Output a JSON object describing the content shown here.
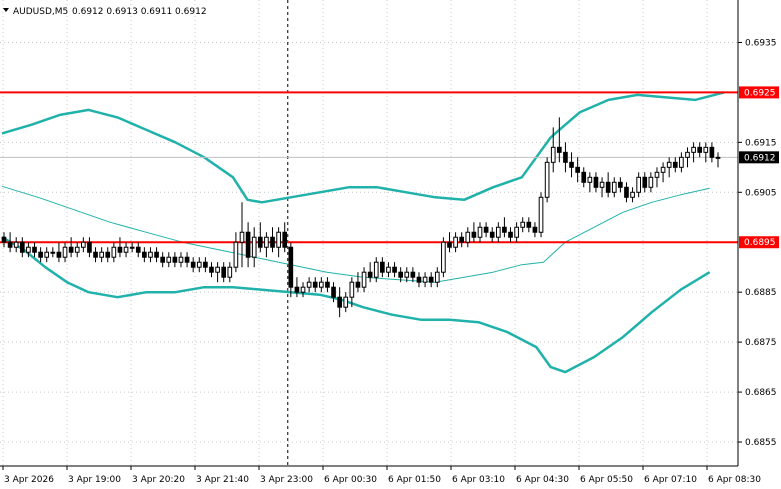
{
  "chart_data": {
    "type": "candlestick",
    "symbol_label": "AUDUSD,M5",
    "ohlc_label": "0.6912 0.6913 0.6911 0.6912",
    "x_ticks": [
      "3 Apr 2026",
      "3 Apr 19:00",
      "3 Apr 20:20",
      "3 Apr 21:40",
      "3 Apr 23:00",
      "6 Apr 00:30",
      "6 Apr 01:50",
      "6 Apr 03:10",
      "6 Apr 04:30",
      "6 Apr 05:50",
      "6 Apr 07:10",
      "6 Apr 08:30"
    ],
    "y_ticks": [
      0.6935,
      0.6915,
      0.6905,
      0.6885,
      0.6875,
      0.6865,
      0.6855
    ],
    "ylim": [
      0.68502,
      0.69435
    ],
    "grid": true,
    "current_price": "0.6912",
    "current_price_value": 0.6912,
    "levels": [
      {
        "label": "0.6925",
        "value": 0.6925
      },
      {
        "label": "0.6895",
        "value": 0.6895
      }
    ],
    "session_break_index": 47,
    "candles": [
      [
        0.6896,
        0.6897,
        0.6894,
        0.6895
      ],
      [
        0.6895,
        0.6897,
        0.6893,
        0.6894
      ],
      [
        0.6894,
        0.6896,
        0.6893,
        0.6895
      ],
      [
        0.6895,
        0.6896,
        0.6892,
        0.6893
      ],
      [
        0.6893,
        0.6895,
        0.6892,
        0.6894
      ],
      [
        0.6894,
        0.6895,
        0.6892,
        0.6893
      ],
      [
        0.6893,
        0.6894,
        0.6891,
        0.6892
      ],
      [
        0.6892,
        0.6894,
        0.6891,
        0.6893
      ],
      [
        0.6893,
        0.6894,
        0.6892,
        0.6893
      ],
      [
        0.6893,
        0.6895,
        0.6891,
        0.6892
      ],
      [
        0.6892,
        0.6895,
        0.6891,
        0.6894
      ],
      [
        0.6894,
        0.6896,
        0.6892,
        0.6893
      ],
      [
        0.6893,
        0.6895,
        0.6892,
        0.6894
      ],
      [
        0.6894,
        0.6896,
        0.6893,
        0.6895
      ],
      [
        0.6895,
        0.6896,
        0.6892,
        0.6893
      ],
      [
        0.6893,
        0.6894,
        0.6891,
        0.6892
      ],
      [
        0.6892,
        0.6894,
        0.6891,
        0.6893
      ],
      [
        0.6893,
        0.6894,
        0.6891,
        0.6892
      ],
      [
        0.6892,
        0.6895,
        0.6891,
        0.6894
      ],
      [
        0.6894,
        0.6896,
        0.6892,
        0.6893
      ],
      [
        0.6893,
        0.6895,
        0.6892,
        0.6894
      ],
      [
        0.6894,
        0.6895,
        0.6893,
        0.6894
      ],
      [
        0.6894,
        0.6895,
        0.6892,
        0.6893
      ],
      [
        0.6893,
        0.6894,
        0.6891,
        0.6892
      ],
      [
        0.6892,
        0.6894,
        0.6891,
        0.6893
      ],
      [
        0.6893,
        0.6894,
        0.6891,
        0.6892
      ],
      [
        0.6892,
        0.6893,
        0.689,
        0.6891
      ],
      [
        0.6891,
        0.6893,
        0.689,
        0.6892
      ],
      [
        0.6892,
        0.6893,
        0.689,
        0.6891
      ],
      [
        0.6891,
        0.6893,
        0.689,
        0.6892
      ],
      [
        0.6892,
        0.6893,
        0.689,
        0.6891
      ],
      [
        0.6891,
        0.6892,
        0.6889,
        0.689
      ],
      [
        0.689,
        0.6892,
        0.6889,
        0.6891
      ],
      [
        0.6891,
        0.6892,
        0.6889,
        0.689
      ],
      [
        0.689,
        0.6891,
        0.6888,
        0.6889
      ],
      [
        0.6889,
        0.6891,
        0.6887,
        0.689
      ],
      [
        0.689,
        0.6891,
        0.6887,
        0.6888
      ],
      [
        0.6888,
        0.6891,
        0.6887,
        0.689
      ],
      [
        0.689,
        0.6897,
        0.6889,
        0.6895
      ],
      [
        0.6895,
        0.6903,
        0.689,
        0.6897
      ],
      [
        0.6897,
        0.6899,
        0.689,
        0.6892
      ],
      [
        0.6892,
        0.6898,
        0.689,
        0.6896
      ],
      [
        0.6896,
        0.6899,
        0.6893,
        0.6894
      ],
      [
        0.6894,
        0.6897,
        0.6892,
        0.6896
      ],
      [
        0.6896,
        0.6898,
        0.6893,
        0.6894
      ],
      [
        0.6894,
        0.6898,
        0.6892,
        0.6897
      ],
      [
        0.6897,
        0.6899,
        0.6893,
        0.6894
      ],
      [
        0.6894,
        0.6895,
        0.6884,
        0.6886
      ],
      [
        0.6886,
        0.6888,
        0.6884,
        0.6885
      ],
      [
        0.6885,
        0.6887,
        0.6884,
        0.6886
      ],
      [
        0.6886,
        0.6888,
        0.6885,
        0.6887
      ],
      [
        0.6887,
        0.6888,
        0.6885,
        0.6886
      ],
      [
        0.6886,
        0.6888,
        0.6885,
        0.6887
      ],
      [
        0.6887,
        0.6888,
        0.6885,
        0.6886
      ],
      [
        0.6886,
        0.6887,
        0.6883,
        0.6884
      ],
      [
        0.6884,
        0.6886,
        0.688,
        0.6882
      ],
      [
        0.6882,
        0.6885,
        0.6881,
        0.6884
      ],
      [
        0.6884,
        0.6888,
        0.6882,
        0.6887
      ],
      [
        0.6887,
        0.6889,
        0.6885,
        0.6886
      ],
      [
        0.6886,
        0.689,
        0.6885,
        0.6889
      ],
      [
        0.6889,
        0.6891,
        0.6887,
        0.6888
      ],
      [
        0.6888,
        0.6892,
        0.6887,
        0.6891
      ],
      [
        0.6891,
        0.6892,
        0.6888,
        0.6889
      ],
      [
        0.6889,
        0.6891,
        0.6888,
        0.689
      ],
      [
        0.689,
        0.6891,
        0.6888,
        0.6889
      ],
      [
        0.6889,
        0.689,
        0.6887,
        0.6888
      ],
      [
        0.6888,
        0.689,
        0.6887,
        0.6889
      ],
      [
        0.6889,
        0.689,
        0.6887,
        0.6888
      ],
      [
        0.6888,
        0.6889,
        0.6886,
        0.6887
      ],
      [
        0.6887,
        0.6889,
        0.6886,
        0.6888
      ],
      [
        0.6888,
        0.6889,
        0.6886,
        0.6887
      ],
      [
        0.6887,
        0.689,
        0.6886,
        0.6889
      ],
      [
        0.6889,
        0.6896,
        0.6888,
        0.6895
      ],
      [
        0.6895,
        0.6897,
        0.6893,
        0.6894
      ],
      [
        0.6894,
        0.6897,
        0.6893,
        0.6896
      ],
      [
        0.6896,
        0.6897,
        0.6894,
        0.6895
      ],
      [
        0.6895,
        0.6898,
        0.6894,
        0.6897
      ],
      [
        0.6897,
        0.6899,
        0.6895,
        0.6896
      ],
      [
        0.6896,
        0.6899,
        0.6895,
        0.6898
      ],
      [
        0.6898,
        0.6899,
        0.6896,
        0.6897
      ],
      [
        0.6897,
        0.6898,
        0.6895,
        0.6896
      ],
      [
        0.6896,
        0.6899,
        0.6895,
        0.6898
      ],
      [
        0.6898,
        0.69,
        0.6896,
        0.6897
      ],
      [
        0.6897,
        0.6898,
        0.6895,
        0.6896
      ],
      [
        0.6896,
        0.6899,
        0.6895,
        0.6898
      ],
      [
        0.6898,
        0.69,
        0.6897,
        0.6899
      ],
      [
        0.6899,
        0.69,
        0.6897,
        0.6898
      ],
      [
        0.6898,
        0.6899,
        0.6896,
        0.6897
      ],
      [
        0.6897,
        0.6905,
        0.6896,
        0.6904
      ],
      [
        0.6904,
        0.6912,
        0.6903,
        0.6911
      ],
      [
        0.6911,
        0.6918,
        0.6909,
        0.6914
      ],
      [
        0.6914,
        0.692,
        0.6911,
        0.6913
      ],
      [
        0.6913,
        0.6915,
        0.6909,
        0.6911
      ],
      [
        0.6911,
        0.6913,
        0.6908,
        0.691
      ],
      [
        0.691,
        0.6912,
        0.6907,
        0.6909
      ],
      [
        0.6909,
        0.691,
        0.6906,
        0.6907
      ],
      [
        0.6907,
        0.6909,
        0.6905,
        0.6908
      ],
      [
        0.6908,
        0.6909,
        0.6905,
        0.6906
      ],
      [
        0.6906,
        0.6908,
        0.6904,
        0.6907
      ],
      [
        0.6907,
        0.6909,
        0.6904,
        0.6905
      ],
      [
        0.6905,
        0.6908,
        0.6904,
        0.6907
      ],
      [
        0.6907,
        0.6908,
        0.6905,
        0.6906
      ],
      [
        0.6906,
        0.6907,
        0.6903,
        0.6904
      ],
      [
        0.6904,
        0.6906,
        0.6903,
        0.6905
      ],
      [
        0.6905,
        0.6909,
        0.6904,
        0.6908
      ],
      [
        0.6908,
        0.6909,
        0.6905,
        0.6906
      ],
      [
        0.6906,
        0.6909,
        0.6905,
        0.6908
      ],
      [
        0.6908,
        0.691,
        0.6906,
        0.6909
      ],
      [
        0.6909,
        0.6911,
        0.6907,
        0.691
      ],
      [
        0.691,
        0.6912,
        0.6908,
        0.6911
      ],
      [
        0.6911,
        0.6912,
        0.6909,
        0.691
      ],
      [
        0.691,
        0.6913,
        0.6909,
        0.6912
      ],
      [
        0.6912,
        0.6914,
        0.691,
        0.6913
      ],
      [
        0.6913,
        0.6915,
        0.6911,
        0.6914
      ],
      [
        0.6914,
        0.6915,
        0.6912,
        0.6913
      ],
      [
        0.6913,
        0.6915,
        0.6911,
        0.6914
      ],
      [
        0.6914,
        0.6915,
        0.6911,
        0.6912
      ],
      [
        0.6912,
        0.6913,
        0.691,
        0.6912
      ]
    ],
    "upper_band": [
      [
        0,
        0.69168
      ],
      [
        0.04,
        0.69185
      ],
      [
        0.08,
        0.69205
      ],
      [
        0.12,
        0.69215
      ],
      [
        0.16,
        0.692
      ],
      [
        0.2,
        0.69175
      ],
      [
        0.24,
        0.6915
      ],
      [
        0.28,
        0.6912
      ],
      [
        0.32,
        0.6908
      ],
      [
        0.34,
        0.69035
      ],
      [
        0.36,
        0.6903
      ],
      [
        0.4,
        0.6904
      ],
      [
        0.44,
        0.6905
      ],
      [
        0.48,
        0.6906
      ],
      [
        0.52,
        0.6906
      ],
      [
        0.56,
        0.6905
      ],
      [
        0.6,
        0.6904
      ],
      [
        0.64,
        0.69035
      ],
      [
        0.68,
        0.6906
      ],
      [
        0.72,
        0.6908
      ],
      [
        0.74,
        0.6912
      ],
      [
        0.76,
        0.6916
      ],
      [
        0.8,
        0.6921
      ],
      [
        0.84,
        0.69235
      ],
      [
        0.88,
        0.69245
      ],
      [
        0.92,
        0.6924
      ],
      [
        0.96,
        0.69235
      ],
      [
        1,
        0.6925
      ]
    ],
    "middle_line": [
      [
        0,
        0.69062
      ],
      [
        0.05,
        0.6904
      ],
      [
        0.1,
        0.69015
      ],
      [
        0.15,
        0.6899
      ],
      [
        0.2,
        0.6897
      ],
      [
        0.25,
        0.6895
      ],
      [
        0.3,
        0.68935
      ],
      [
        0.35,
        0.6892
      ],
      [
        0.4,
        0.68905
      ],
      [
        0.45,
        0.6889
      ],
      [
        0.5,
        0.6888
      ],
      [
        0.55,
        0.68875
      ],
      [
        0.6,
        0.6887
      ],
      [
        0.64,
        0.6888
      ],
      [
        0.68,
        0.6889
      ],
      [
        0.72,
        0.68905
      ],
      [
        0.75,
        0.6891
      ],
      [
        0.78,
        0.6895
      ],
      [
        0.82,
        0.6898
      ],
      [
        0.86,
        0.6901
      ],
      [
        0.9,
        0.6903
      ],
      [
        0.94,
        0.69045
      ],
      [
        0.98,
        0.69058
      ]
    ],
    "lower_band": [
      [
        0,
        0.6896
      ],
      [
        0.03,
        0.68935
      ],
      [
        0.06,
        0.689
      ],
      [
        0.09,
        0.6887
      ],
      [
        0.12,
        0.6885
      ],
      [
        0.16,
        0.6884
      ],
      [
        0.2,
        0.6885
      ],
      [
        0.24,
        0.6885
      ],
      [
        0.28,
        0.6886
      ],
      [
        0.32,
        0.6886
      ],
      [
        0.36,
        0.68855
      ],
      [
        0.4,
        0.6885
      ],
      [
        0.44,
        0.68845
      ],
      [
        0.47,
        0.68835
      ],
      [
        0.5,
        0.6882
      ],
      [
        0.54,
        0.68805
      ],
      [
        0.58,
        0.68795
      ],
      [
        0.62,
        0.68795
      ],
      [
        0.66,
        0.6879
      ],
      [
        0.7,
        0.6877
      ],
      [
        0.74,
        0.6874
      ],
      [
        0.76,
        0.687
      ],
      [
        0.78,
        0.6869
      ],
      [
        0.82,
        0.6872
      ],
      [
        0.86,
        0.6876
      ],
      [
        0.9,
        0.6881
      ],
      [
        0.94,
        0.68855
      ],
      [
        0.98,
        0.6889
      ]
    ],
    "colors": {
      "candle": "#000000",
      "band": "#20b2aa",
      "level": "#ff0000",
      "grid": "#c8c8c8",
      "current_price_tag_bg": "#000000",
      "current_price_tag_text": "#ffffff"
    }
  }
}
